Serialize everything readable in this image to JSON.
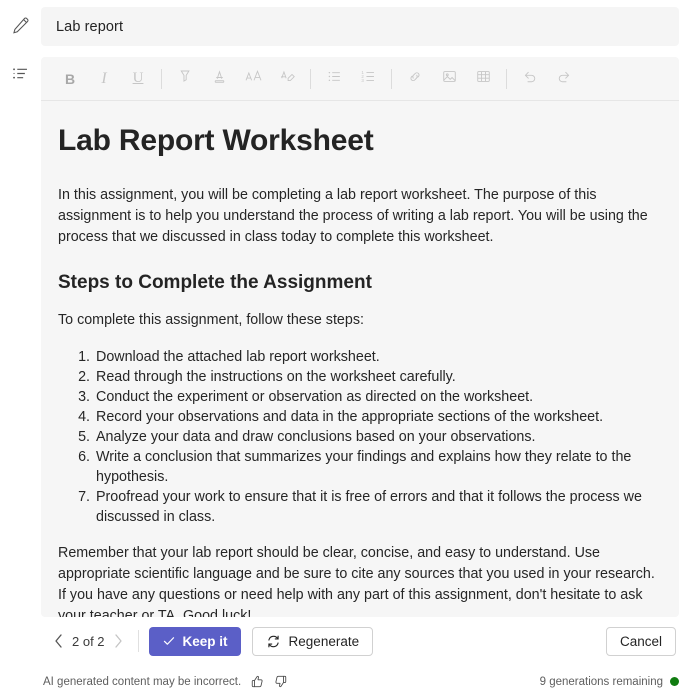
{
  "rail": {
    "items": [
      {
        "name": "pencil-icon",
        "label": "Edit"
      },
      {
        "name": "list-icon",
        "label": "Outline"
      }
    ]
  },
  "title_field": {
    "value": "Lab report",
    "placeholder": "Title"
  },
  "toolbar": {
    "items": [
      {
        "name": "bold-button",
        "glyph": "B",
        "label": "Bold"
      },
      {
        "name": "italic-button",
        "glyph": "I",
        "label": "Italic"
      },
      {
        "name": "underline-button",
        "glyph": "U",
        "label": "Underline"
      },
      {
        "name": "highlight-button",
        "glyph": "",
        "label": "Highlight"
      },
      {
        "name": "font-color-button",
        "glyph": "",
        "label": "Font color"
      },
      {
        "name": "font-size-button",
        "glyph": "",
        "label": "Font size"
      },
      {
        "name": "clear-formatting-button",
        "glyph": "",
        "label": "Clear formatting"
      },
      {
        "name": "bulleted-list-button",
        "glyph": "",
        "label": "Bulleted list"
      },
      {
        "name": "numbered-list-button",
        "glyph": "",
        "label": "Numbered list"
      },
      {
        "name": "link-button",
        "glyph": "",
        "label": "Insert link"
      },
      {
        "name": "image-button",
        "glyph": "",
        "label": "Insert image"
      },
      {
        "name": "table-button",
        "glyph": "",
        "label": "Insert table"
      },
      {
        "name": "undo-button",
        "glyph": "",
        "label": "Undo"
      },
      {
        "name": "redo-button",
        "glyph": "",
        "label": "Redo"
      }
    ]
  },
  "document": {
    "heading": "Lab Report Worksheet",
    "intro": "In this assignment, you will be completing a lab report worksheet. The purpose of this assignment is to help you understand the process of writing a lab report. You will be using the process that we discussed in class today to complete this worksheet.",
    "subheading": "Steps to Complete the Assignment",
    "steps_lead": "To complete this assignment, follow these steps:",
    "steps": [
      "Download the attached lab report worksheet.",
      "Read through the instructions on the worksheet carefully.",
      "Conduct the experiment or observation as directed on the worksheet.",
      "Record your observations and data in the appropriate sections of the worksheet.",
      "Analyze your data and draw conclusions based on your observations.",
      "Write a conclusion that summarizes your findings and explains how they relate to the hypothesis.",
      "Proofread your work to ensure that it is free of errors and that it follows the process we discussed in class."
    ],
    "closing_1": "Remember that your lab report should be clear, concise, and easy to understand. Use appropriate scientific language and be sure to cite any sources that you used in your research.",
    "closing_2": "If you have any questions or need help with any part of this assignment, don't hesitate to ask your teacher or TA. Good luck!"
  },
  "actions": {
    "pager": {
      "previous_label": "‹",
      "next_label": "›",
      "counter": "2 of 2",
      "current": 2,
      "total": 2
    },
    "keep_it_label": "Keep it",
    "regenerate_label": "Regenerate",
    "cancel_label": "Cancel",
    "accent_color": "#5b5fc7"
  },
  "footer": {
    "disclaimer": "AI generated content may be incorrect.",
    "thumbs_up_name": "thumbs-up-icon",
    "thumbs_down_name": "thumbs-down-icon",
    "generations_remaining": "9 generations remaining",
    "status_color": "#107c10"
  }
}
